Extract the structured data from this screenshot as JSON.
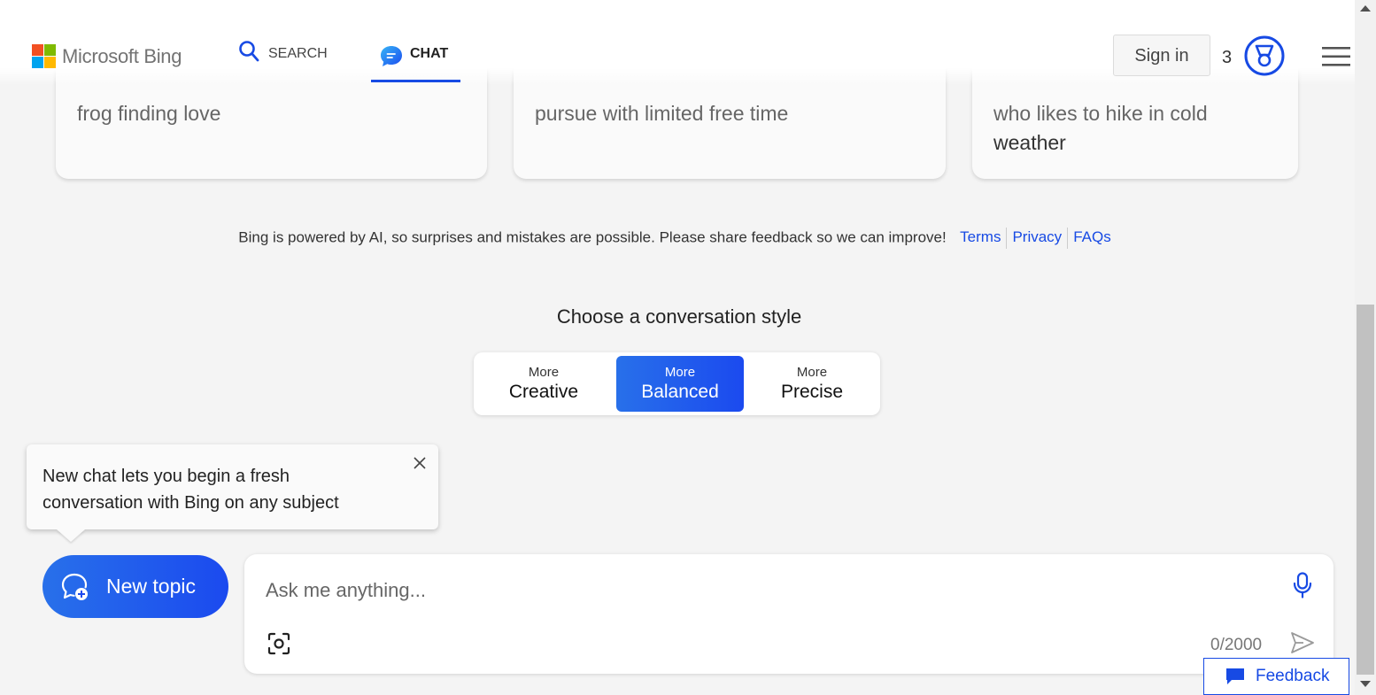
{
  "header": {
    "logo_text": "Microsoft Bing",
    "nav": {
      "search_label": "SEARCH",
      "chat_label": "CHAT"
    },
    "signin_label": "Sign in",
    "rewards_count": "3",
    "icons": {
      "search": "search-icon",
      "chat": "chat-bubble-icon",
      "rewards": "rewards-medal-icon",
      "menu": "hamburger-menu-icon"
    }
  },
  "suggestion_cards": [
    {
      "line1": "frog finding love",
      "line2": ""
    },
    {
      "line1": "pursue with limited free time",
      "line2": ""
    },
    {
      "line1": "who likes to hike in cold",
      "line2": "weather"
    }
  ],
  "disclaimer": {
    "text": "Bing is powered by AI, so surprises and mistakes are possible. Please share feedback so we can improve!",
    "links": {
      "terms": "Terms",
      "privacy": "Privacy",
      "faqs": "FAQs"
    }
  },
  "conversation_style": {
    "title": "Choose a conversation style",
    "options": [
      {
        "prefix": "More",
        "label": "Creative",
        "selected": false
      },
      {
        "prefix": "More",
        "label": "Balanced",
        "selected": true
      },
      {
        "prefix": "More",
        "label": "Precise",
        "selected": false
      }
    ]
  },
  "tooltip": {
    "text": "New chat lets you begin a fresh conversation with Bing on any subject"
  },
  "new_topic": {
    "label": "New topic"
  },
  "input": {
    "placeholder": "Ask me anything...",
    "value": "",
    "char_count": "0/2000"
  },
  "feedback": {
    "label": "Feedback"
  },
  "colors": {
    "accent": "#174ae4",
    "accent_gradient_start": "#2870ea",
    "accent_gradient_end": "#1b4aef",
    "page_background": "#f4f4f4",
    "ms_logo": [
      "#f25022",
      "#7fba00",
      "#00a4ef",
      "#ffb900"
    ]
  }
}
